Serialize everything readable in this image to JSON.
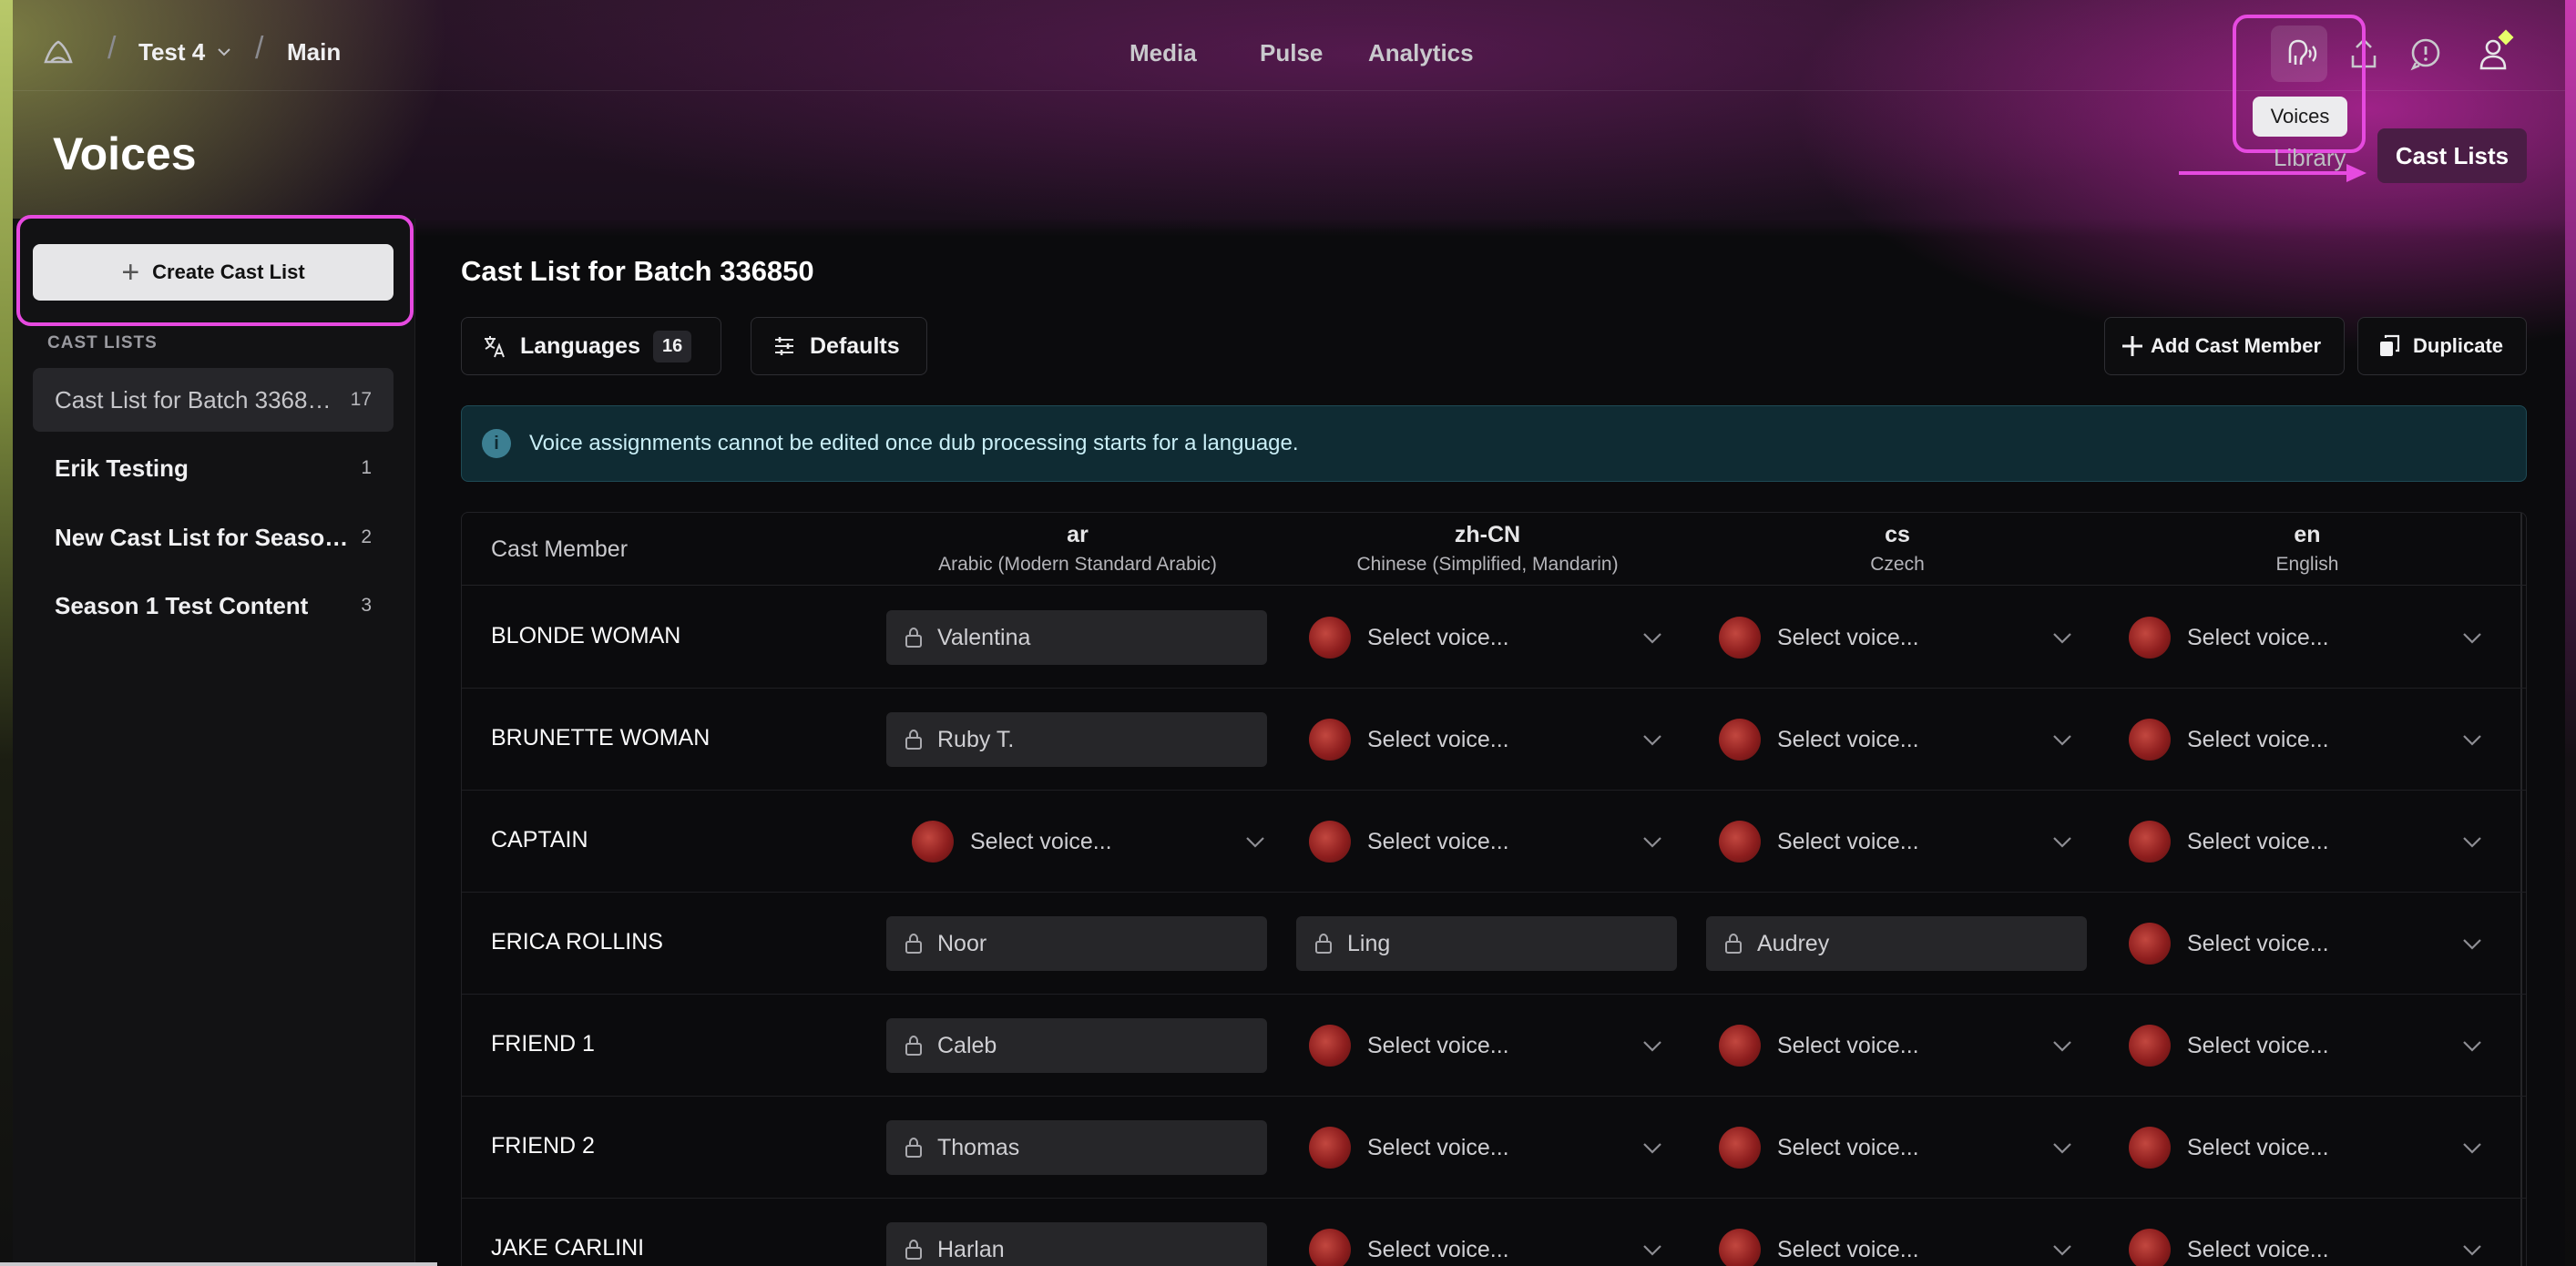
{
  "header": {
    "breadcrumb": {
      "project": "Test 4",
      "branch": "Main"
    },
    "nav": [
      "Media",
      "Pulse",
      "Analytics"
    ],
    "icons": [
      "voices-icon",
      "upload-icon",
      "message-icon",
      "user-icon"
    ],
    "tooltip": "Voices"
  },
  "page": {
    "title": "Voices",
    "tabs": {
      "library": "Library",
      "cast_lists": "Cast Lists"
    }
  },
  "sidebar": {
    "create_button": "Create Cast List",
    "section_label": "CAST LISTS",
    "items": [
      {
        "name": "Cast List for Batch 3368…",
        "count": "17",
        "active": true
      },
      {
        "name": "Erik Testing",
        "count": "1"
      },
      {
        "name": "New Cast List for Season 2",
        "count": "2"
      },
      {
        "name": "Season 1 Test Content",
        "count": "3"
      }
    ]
  },
  "main": {
    "title": "Cast List for Batch 336850",
    "languages_label": "Languages",
    "languages_count": "16",
    "defaults_label": "Defaults",
    "add_member_label": "Add Cast Member",
    "duplicate_label": "Duplicate",
    "info": "Voice assignments cannot be edited once dub processing starts for a language."
  },
  "table": {
    "cast_header": "Cast Member",
    "languages": [
      {
        "code": "ar",
        "name": "Arabic (Modern Standard Arabic)"
      },
      {
        "code": "zh-CN",
        "name": "Chinese (Simplified, Mandarin)"
      },
      {
        "code": "cs",
        "name": "Czech"
      },
      {
        "code": "en",
        "name": "English"
      }
    ],
    "select_placeholder": "Select voice...",
    "rows": [
      {
        "name": "BLONDE WOMAN",
        "cells": [
          "Valentina",
          null,
          null,
          null
        ]
      },
      {
        "name": "BRUNETTE WOMAN",
        "cells": [
          "Ruby T.",
          null,
          null,
          null
        ]
      },
      {
        "name": "CAPTAIN",
        "cells": [
          null,
          null,
          null,
          null
        ]
      },
      {
        "name": "ERICA ROLLINS",
        "cells": [
          "Noor",
          "Ling",
          "Audrey",
          null
        ]
      },
      {
        "name": "FRIEND 1",
        "cells": [
          "Caleb",
          null,
          null,
          null
        ]
      },
      {
        "name": "FRIEND 2",
        "cells": [
          "Thomas",
          null,
          null,
          null
        ]
      },
      {
        "name": "JAKE CARLINI",
        "cells": [
          "Harlan",
          null,
          null,
          null
        ]
      }
    ]
  },
  "colors": {
    "accent": "#e64ae0",
    "active_tab": "#4a1d45",
    "info_bg": "#0f2b33",
    "avatar": "#a32b2b"
  }
}
